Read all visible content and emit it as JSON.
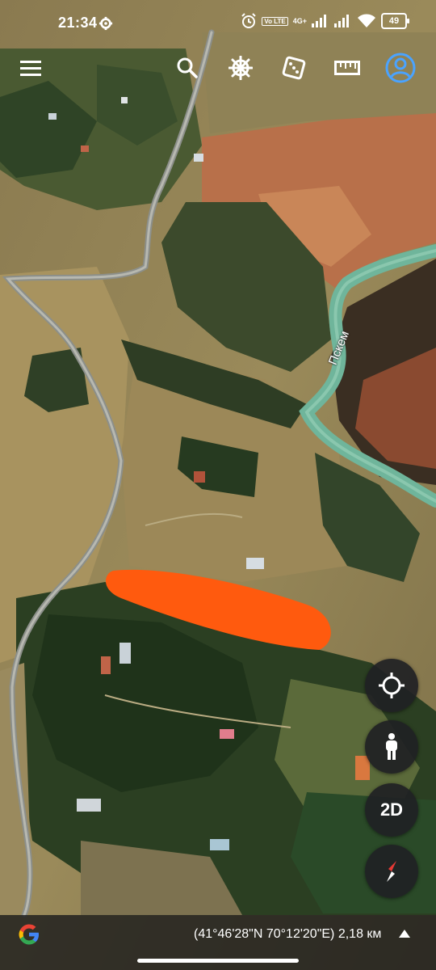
{
  "status_bar": {
    "time": "21:34",
    "network_tag": "4G+",
    "volte_tag": "Vo LTE",
    "battery": "49"
  },
  "toolbar": {
    "icons": [
      "menu-icon",
      "search-icon",
      "voyager-wheel-icon",
      "dice-icon",
      "ruler-icon",
      "account-icon"
    ],
    "accent_color": "#4aa3ff"
  },
  "map": {
    "river_label": "Пскем",
    "redaction_color": "#ff5a0e",
    "river_color": "#6fb59b"
  },
  "controls": {
    "mode_button": "2D",
    "icons": [
      "my-location-icon",
      "pegman-icon",
      "compass-icon"
    ]
  },
  "bottom_bar": {
    "coordinates": "(41°46'28\"N 70°12'20\"E) 2,18 км"
  }
}
